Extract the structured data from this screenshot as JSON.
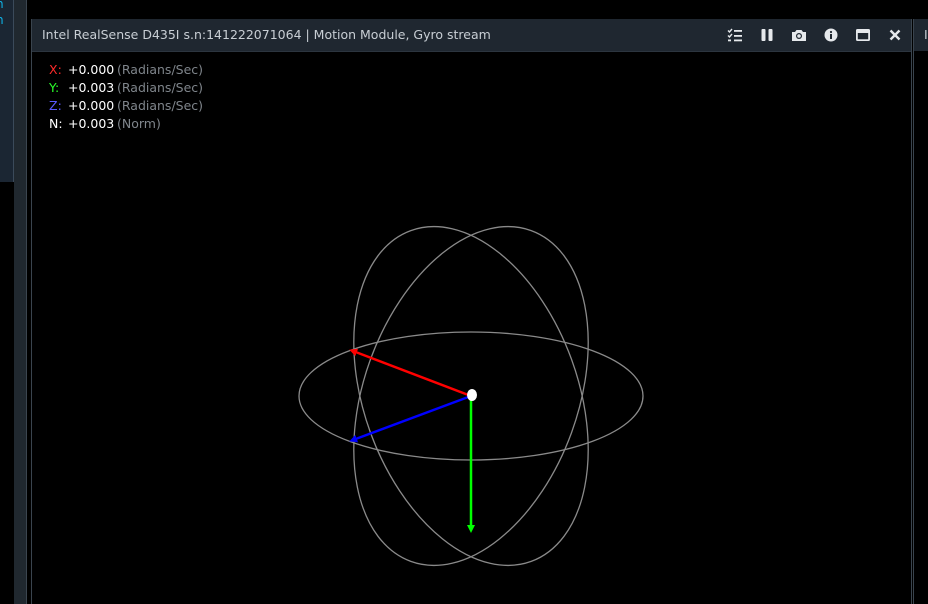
{
  "left_panel": {
    "text_lines": [
      "n",
      "n"
    ],
    "accent_color": "#0fb3e8"
  },
  "viewer": {
    "title": "Intel RealSense D435I s.n:141222071064 | Motion Module, Gyro stream",
    "toolbar": {
      "icons": [
        "checklist-icon",
        "pause-icon",
        "camera-icon",
        "info-icon",
        "maximize-icon",
        "close-icon"
      ]
    },
    "readouts": [
      {
        "axis": "X:",
        "value": "+0.000",
        "unit": "(Radians/Sec)",
        "color": "#ff2a2a"
      },
      {
        "axis": "Y:",
        "value": "+0.003",
        "unit": "(Radians/Sec)",
        "color": "#2aff2a"
      },
      {
        "axis": "Z:",
        "value": "+0.000",
        "unit": "(Radians/Sec)",
        "color": "#5a5aff"
      },
      {
        "axis": "N:",
        "value": "+0.003",
        "unit": "(Norm)",
        "color": "#ffffff"
      }
    ],
    "gizmo": {
      "arrow_colors": {
        "x": "#ff0000",
        "y": "#00ff00",
        "z": "#0000ff"
      },
      "ring_color": "#8a8a8a"
    }
  },
  "right_panel": {
    "title_char": "I"
  }
}
